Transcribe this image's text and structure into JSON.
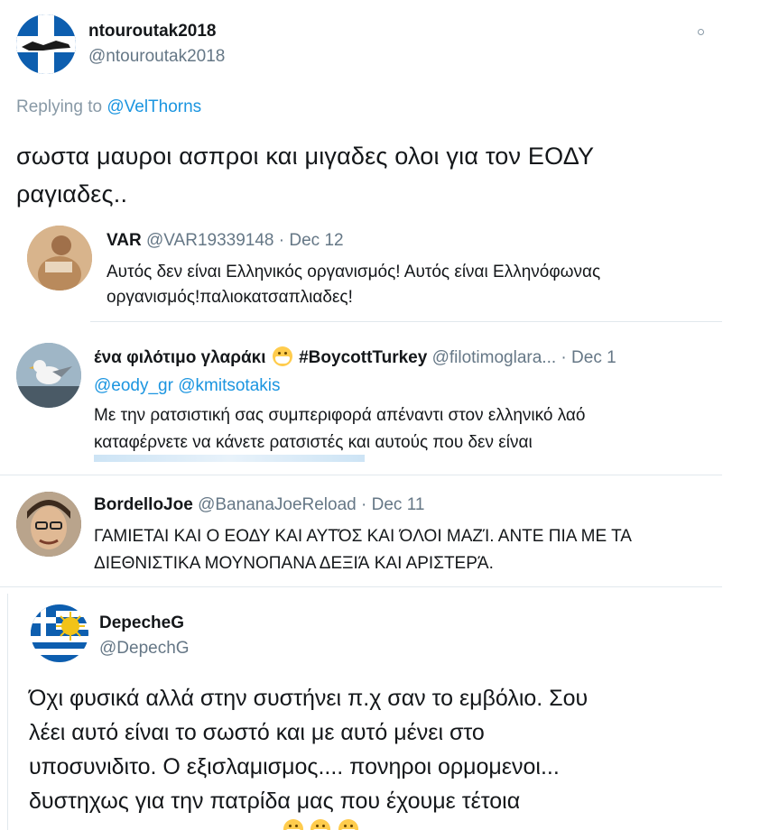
{
  "main_tweet": {
    "display_name": "ntouroutak2018",
    "handle": "@ntouroutak2018",
    "replying_prefix": "Replying to",
    "replying_to": "@VelThorns",
    "text_line1": "σωστα μαυροι ασπροι και μιγαδες ολοι για τον ΕΟΔΥ",
    "text_line2": "ραγιαδες..",
    "more_icon": "dot-icon"
  },
  "replies": [
    {
      "display_name": "VAR",
      "handle": "@VAR19339148",
      "sep": "·",
      "date": "Dec 12",
      "line1": "Αυτός δεν είναι Ελληνικός οργανισμός! Αυτός είναι Ελληνόφωνας",
      "line2": "οργανισμός!παλιοκατσαπλιαδες!"
    },
    {
      "display_name": "ένα φιλότιμο γλαράκι",
      "emoji": "mask-face-emoji",
      "hashtag": "#BoycottTurkey",
      "handle": "@filotimoglara...",
      "sep": "·",
      "date": "Dec 1",
      "mention1": "@eody_gr",
      "mention2": "@kmitsotakis",
      "line1": "Με την ρατσιστική σας συμπεριφορά απέναντι στον ελληνικό λαό",
      "line2": "καταφέρνετε να κάνετε ρατσιστές και αυτούς που δεν είναι"
    },
    {
      "display_name": "BordelloJoe",
      "handle": "@BananaJoeReload",
      "sep": "·",
      "date": "Dec 11",
      "line1": "ΓΑΜΙΕΤΑΙ ΚΑΙ Ο ΕΟΔΥ ΚΑΙ ΑΥΤΌΣ ΚΑΙ ΌΛΟΙ ΜΑΖΊ. ΑΝΤΕ ΠΙΑ ΜΕ ΤΑ",
      "line2": "ΔΙΕΘΝΙΣΤΙΚΑ ΜΟΥΝΟΠΑΝΑ ΔΕΞΙΆ ΚΑΙ ΑΡΙΣΤΕΡΆ."
    }
  ],
  "bottom_tweet": {
    "display_name": "DepecheG",
    "handle": "@DepechG",
    "line1": "Όχι φυσικά αλλά στην συστήνει π.χ σαν το εμβόλιο. Σου",
    "line2": "λέει αυτό είναι το σωστό και με αυτό  μένει στο",
    "line3": "υποσυνιδιτο. Ο εξισλαμισμος.... πονηροι ορμομενοι...",
    "line4": "δυστηχως για την πατρίδα μας που έχουμε τέτοια"
  },
  "colors": {
    "link": "#1b95e0",
    "muted": "#657786",
    "divider": "#e1e8ed"
  }
}
